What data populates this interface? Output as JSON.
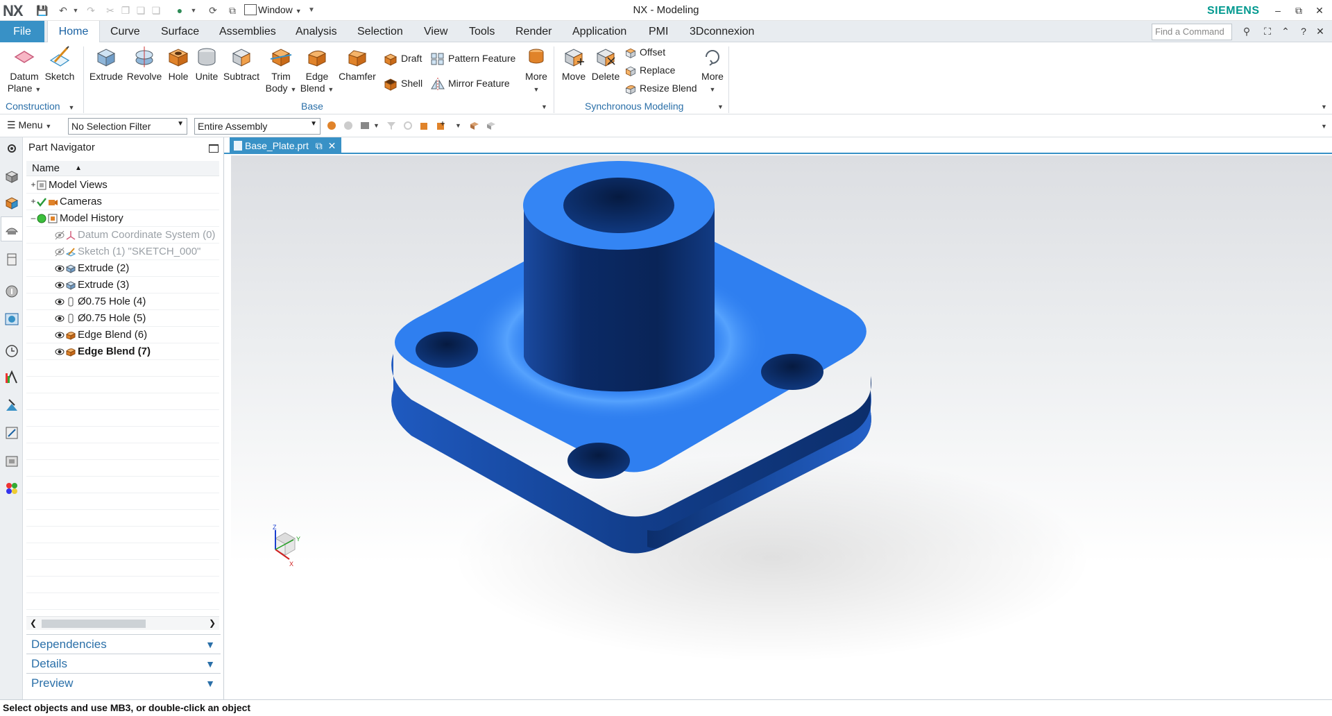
{
  "window": {
    "title": "NX - Modeling",
    "brand": "SIEMENS",
    "logo": "NX"
  },
  "qat": {
    "window_label": "Window"
  },
  "tabs": [
    {
      "label": "File"
    },
    {
      "label": "Home"
    },
    {
      "label": "Curve"
    },
    {
      "label": "Surface"
    },
    {
      "label": "Assemblies"
    },
    {
      "label": "Analysis"
    },
    {
      "label": "Selection"
    },
    {
      "label": "View"
    },
    {
      "label": "Tools"
    },
    {
      "label": "Render"
    },
    {
      "label": "Application"
    },
    {
      "label": "PMI"
    },
    {
      "label": "3Dconnexion"
    }
  ],
  "command_search": {
    "placeholder": "Find a Command"
  },
  "ribbon": {
    "construction": {
      "label": "Construction",
      "datum_plane_1": "Datum",
      "datum_plane_2": "Plane",
      "sketch": "Sketch"
    },
    "base": {
      "label": "Base",
      "extrude": "Extrude",
      "revolve": "Revolve",
      "hole": "Hole",
      "unite": "Unite",
      "subtract": "Subtract",
      "trim_body_1": "Trim",
      "trim_body_2": "Body",
      "edge_blend_1": "Edge",
      "edge_blend_2": "Blend",
      "chamfer": "Chamfer",
      "draft": "Draft",
      "shell": "Shell",
      "pattern_feature": "Pattern Feature",
      "mirror_feature": "Mirror Feature",
      "more": "More"
    },
    "sync": {
      "label": "Synchronous Modeling",
      "move": "Move",
      "delete": "Delete",
      "offset": "Offset",
      "replace": "Replace",
      "resize_blend": "Resize Blend",
      "more": "More"
    }
  },
  "selection_bar": {
    "menu": "Menu",
    "filter": "No Selection Filter",
    "scope": "Entire Assembly"
  },
  "navigator": {
    "title": "Part Navigator",
    "column_name": "Name",
    "rows": [
      {
        "label": "Model Views"
      },
      {
        "label": "Cameras"
      },
      {
        "label": "Model History"
      },
      {
        "label": "Datum Coordinate System (0)"
      },
      {
        "label": "Sketch (1) \"SKETCH_000\""
      },
      {
        "label": "Extrude (2)"
      },
      {
        "label": "Extrude (3)"
      },
      {
        "label": "Ø0.75 Hole (4)"
      },
      {
        "label": "Ø0.75 Hole (5)"
      },
      {
        "label": "Edge Blend (6)"
      },
      {
        "label": "Edge Blend (7)"
      }
    ],
    "sections": {
      "dependencies": "Dependencies",
      "details": "Details",
      "preview": "Preview"
    }
  },
  "document": {
    "tab_label": "Base_Plate.prt"
  },
  "triad": {
    "z": "Z",
    "y": "Y",
    "x": "X"
  },
  "status": {
    "message": "Select objects and use MB3, or double-click an object"
  },
  "colors": {
    "accent": "#3891c6",
    "model_blue": "#2f7ff0",
    "brand": "#00998f",
    "group_label": "#2a6fa8"
  }
}
